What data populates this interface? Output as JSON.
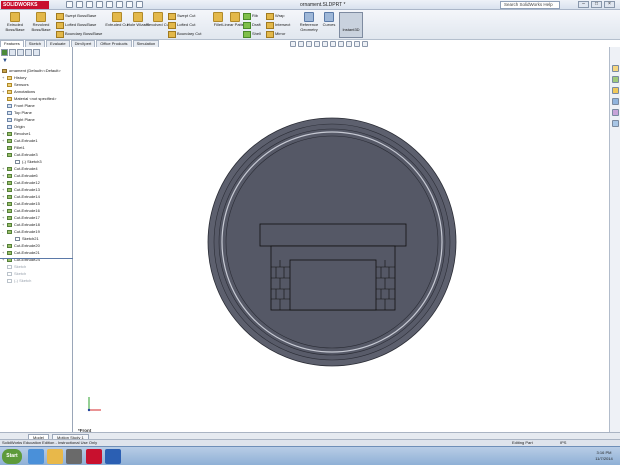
{
  "app": {
    "logo": "SOLIDWORKS",
    "doc_title": "ornament.SLDPRT *",
    "search_placeholder": "Search SolidWorks Help"
  },
  "window_controls": [
    "–",
    "□",
    "×"
  ],
  "ribbon": {
    "big_buttons": [
      {
        "label": "Extruded Boss/Base"
      },
      {
        "label": "Revolved Boss/Base"
      },
      {
        "label": "Extruded Cut"
      },
      {
        "label": "Hole Wizard"
      },
      {
        "label": "Revolved Cut"
      },
      {
        "label": "Fillet"
      },
      {
        "label": "Linear Pattern"
      },
      {
        "label": "Reference Geometry"
      },
      {
        "label": "Curves"
      }
    ],
    "small_buttons": [
      {
        "label": "Swept Boss/Base"
      },
      {
        "label": "Lofted Boss/Base"
      },
      {
        "label": "Boundary Boss/Base"
      },
      {
        "label": "Swept Cut"
      },
      {
        "label": "Lofted Cut"
      },
      {
        "label": "Boundary Cut"
      },
      {
        "label": "Rib"
      },
      {
        "label": "Draft"
      },
      {
        "label": "Shell"
      },
      {
        "label": "Wrap"
      },
      {
        "label": "Intersect"
      },
      {
        "label": "Mirror"
      }
    ],
    "instant3d_label": "Instant3D"
  },
  "command_tabs": [
    "Features",
    "Sketch",
    "Evaluate",
    "DimXpert",
    "Office Products",
    "Simulation"
  ],
  "feature_tree": {
    "part_name": "ornament  (Default<<Default>",
    "items": [
      {
        "label": "History",
        "icon": "folder-icon",
        "expand": "+"
      },
      {
        "label": "Sensors",
        "icon": "folder-icon",
        "expand": ""
      },
      {
        "label": "Annotations",
        "icon": "folder-icon",
        "expand": "+"
      },
      {
        "label": "Material <not specified>",
        "icon": "material-icon",
        "expand": ""
      },
      {
        "label": "Front Plane",
        "icon": "plane-icon",
        "expand": ""
      },
      {
        "label": "Top Plane",
        "icon": "plane-icon",
        "expand": ""
      },
      {
        "label": "Right Plane",
        "icon": "plane-icon",
        "expand": ""
      },
      {
        "label": "Origin",
        "icon": "origin-icon",
        "expand": ""
      },
      {
        "label": "Revolve1",
        "icon": "feature-icon",
        "expand": "+"
      },
      {
        "label": "Cut-Extrude1",
        "icon": "feature-icon",
        "expand": "+"
      },
      {
        "label": "Fillet1",
        "icon": "feature-icon",
        "expand": ""
      },
      {
        "label": "Cut-Extrude3",
        "icon": "feature-icon",
        "expand": "-"
      },
      {
        "label": "(-) Sketch3",
        "icon": "sketch-icon",
        "expand": "",
        "indent": true
      },
      {
        "label": "Cut-Extrude4",
        "icon": "feature-icon",
        "expand": "+"
      },
      {
        "label": "Cut-Extrude6",
        "icon": "feature-icon",
        "expand": "+"
      },
      {
        "label": "Cut-Extrude12",
        "icon": "feature-icon",
        "expand": "+"
      },
      {
        "label": "Cut-Extrude13",
        "icon": "feature-icon",
        "expand": "+"
      },
      {
        "label": "Cut-Extrude14",
        "icon": "feature-icon",
        "expand": "+"
      },
      {
        "label": "Cut-Extrude15",
        "icon": "feature-icon",
        "expand": "+"
      },
      {
        "label": "Cut-Extrude16",
        "icon": "feature-icon",
        "expand": "+"
      },
      {
        "label": "Cut-Extrude17",
        "icon": "feature-icon",
        "expand": "+"
      },
      {
        "label": "Cut-Extrude18",
        "icon": "feature-icon",
        "expand": "+"
      },
      {
        "label": "Cut-Extrude19",
        "icon": "feature-icon",
        "expand": "-"
      },
      {
        "label": "Sketch21",
        "icon": "sketch-icon",
        "expand": "",
        "indent": true
      },
      {
        "label": "Cut-Extrude20",
        "icon": "feature-icon",
        "expand": "+"
      },
      {
        "label": "Cut-Extrude21",
        "icon": "feature-icon",
        "expand": "+"
      },
      {
        "label": "Cut-Extrude24",
        "icon": "feature-icon",
        "expand": "+"
      },
      {
        "label": "Sketch",
        "icon": "sketch-icon",
        "expand": "",
        "dim": true
      },
      {
        "label": "Sketch",
        "icon": "sketch-icon",
        "expand": "",
        "dim": true
      },
      {
        "label": "(-) Sketch",
        "icon": "sketch-icon",
        "expand": "",
        "dim": true
      }
    ]
  },
  "viewport": {
    "view_name": "*Front",
    "model_color": "#585b69",
    "model_edge_color": "#2a2c35",
    "background": "#ffffff"
  },
  "bottom_tabs": [
    "Model",
    "Motion Study 1"
  ],
  "status": {
    "left": "SolidWorks Education Edition - Instructional Use Only",
    "mode": "Editing Part",
    "units": "IPS"
  },
  "taskbar": {
    "start_label": "Start",
    "time": "3:16 PM",
    "date": "11/7/2014"
  },
  "colors": {
    "accent": "#c8102e",
    "taskbar": "#8fb0d6"
  }
}
